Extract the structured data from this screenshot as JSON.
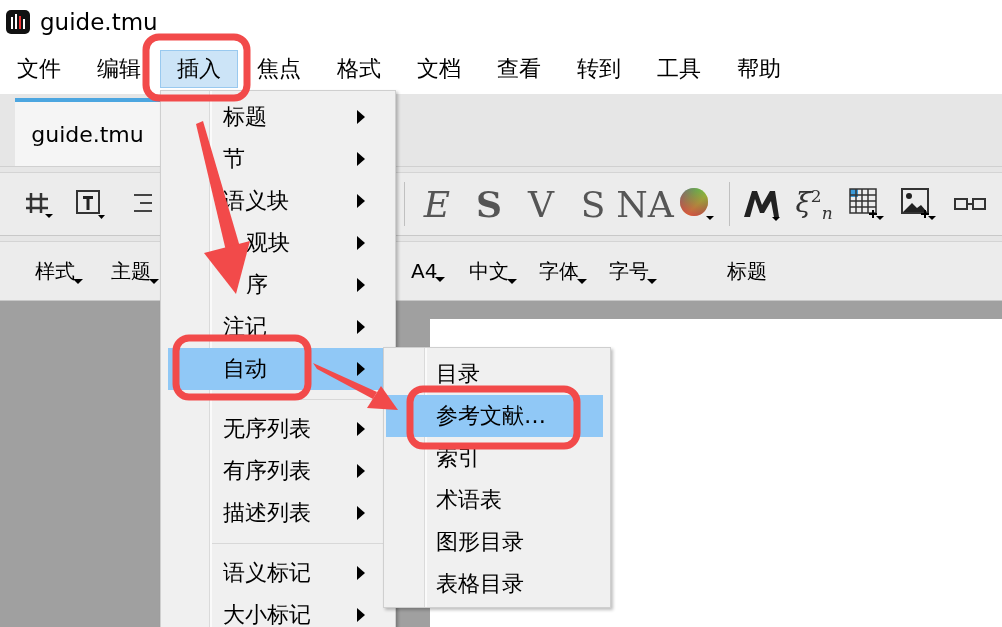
{
  "window": {
    "title": "guide.tmu"
  },
  "menu_bar": [
    {
      "label": "文件",
      "selected": false
    },
    {
      "label": "编辑",
      "selected": false
    },
    {
      "label": "插入",
      "selected": true
    },
    {
      "label": "焦点",
      "selected": false
    },
    {
      "label": "格式",
      "selected": false
    },
    {
      "label": "文档",
      "selected": false
    },
    {
      "label": "查看",
      "selected": false
    },
    {
      "label": "转到",
      "selected": false
    },
    {
      "label": "工具",
      "selected": false
    },
    {
      "label": "帮助",
      "selected": false
    }
  ],
  "tabs": [
    {
      "label": "guide.tmu",
      "selected": true
    }
  ],
  "font_buttons": [
    "E",
    "S",
    "V",
    "S",
    "NA"
  ],
  "math_button": "ξ$^{2}$$_{n}$",
  "format_bar": [
    {
      "label": "样式",
      "dropdown": true
    },
    {
      "label": "主题",
      "dropdown": true
    },
    {
      "label": "A4",
      "dropdown": true
    },
    {
      "label": "中文",
      "dropdown": true
    },
    {
      "label": "字体",
      "dropdown": true
    },
    {
      "label": "字号",
      "dropdown": true
    },
    {
      "label": "标题",
      "dropdown": false
    }
  ],
  "insert_menu": [
    {
      "kind": "item",
      "label": "标题",
      "submenu": true,
      "selected": false
    },
    {
      "kind": "item",
      "label": "节",
      "submenu": true,
      "selected": false
    },
    {
      "kind": "item",
      "label": "语义块",
      "submenu": true,
      "selected": false
    },
    {
      "kind": "covered_item",
      "label": "观块",
      "submenu": true,
      "selected": false
    },
    {
      "kind": "covered_item",
      "label": "序",
      "submenu": true,
      "selected": false
    },
    {
      "kind": "item",
      "label": "注记",
      "submenu": true,
      "selected": false
    },
    {
      "kind": "item",
      "label": "自动",
      "submenu": true,
      "selected": true
    },
    {
      "kind": "separator"
    },
    {
      "kind": "item",
      "label": "无序列表",
      "submenu": true,
      "selected": false
    },
    {
      "kind": "item",
      "label": "有序列表",
      "submenu": true,
      "selected": false
    },
    {
      "kind": "item",
      "label": "描述列表",
      "submenu": true,
      "selected": false
    },
    {
      "kind": "separator"
    },
    {
      "kind": "item",
      "label": "语义标记",
      "submenu": true,
      "selected": false
    },
    {
      "kind": "item",
      "label": "大小标记",
      "submenu": true,
      "selected": false
    }
  ],
  "auto_submenu": [
    {
      "label": "目录",
      "selected": false
    },
    {
      "label": "参考文献…",
      "selected": true
    },
    {
      "label": "索引",
      "selected": false
    },
    {
      "label": "术语表",
      "selected": false
    },
    {
      "label": "图形目录",
      "selected": false
    },
    {
      "label": "表格目录",
      "selected": false
    }
  ]
}
